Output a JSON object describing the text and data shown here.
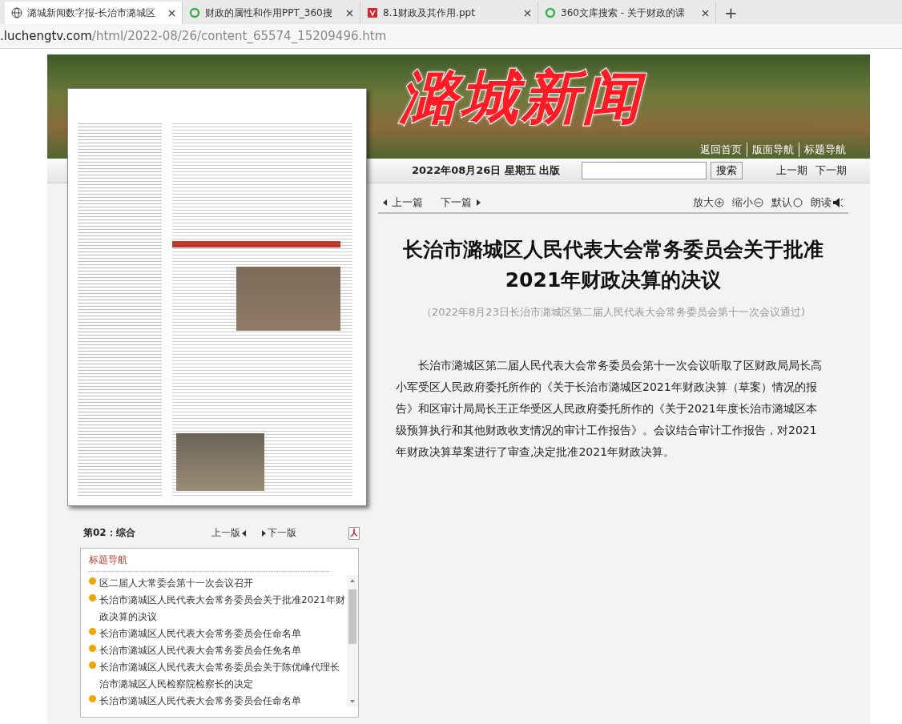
{
  "browser": {
    "tabs": [
      {
        "title": "潞城新闻数字报-长治市潞城区",
        "kind": "globe",
        "selected": true
      },
      {
        "title": "财政的属性和作用PPT_360搜",
        "kind": "ring",
        "selected": false
      },
      {
        "title": "8.1财政及其作用.ppt",
        "kind": "doc",
        "selected": false
      },
      {
        "title": "360文库搜索 - 关于财政的课",
        "kind": "ring",
        "selected": false
      }
    ],
    "new_tab": "+",
    "address": {
      "host": ".luchengtv.com",
      "path": "/html/2022-08/26/content_65574_15209496.htm"
    }
  },
  "banner": {
    "logo": "潞城新闻",
    "links": [
      "返回首页",
      "版面导航",
      "标题导航"
    ]
  },
  "date_bar": {
    "date": "2022年08月26日 星期五 出版",
    "search_button": "搜索",
    "prev_issue": "上一期",
    "next_issue": "下一期"
  },
  "article_nav": {
    "prev": "上一篇",
    "next": "下一篇",
    "tools": [
      {
        "label": "放大",
        "kind": "plus"
      },
      {
        "label": "缩小",
        "kind": "minus"
      },
      {
        "label": "默认",
        "kind": "circle"
      },
      {
        "label": "朗读",
        "kind": "speaker"
      }
    ]
  },
  "article": {
    "title": "长治市潞城区人民代表大会常务委员会关于批准2021年财政决算的决议",
    "subtitle": "（2022年8月23日长治市潞城区第二届人民代表大会常务委员会第十一次会议通过)",
    "body": "长治市潞城区第二届人民代表大会常务委员会第十一次会议听取了区财政局局长高小军受区人民政府委托所作的《关于长治市潞城区2021年财政决算（草案）情况的报告》和区审计局局长王正华受区人民政府委托所作的《关于2021年度长治市潞城区本级预算执行和其他财政收支情况的审计工作报告》。会议结合审计工作报告，对2021年财政决算草案进行了审查,决定批准2021年财政决算。"
  },
  "page_nav": {
    "page_label": "第02：综合",
    "prev_page": "上一版",
    "next_page": "下一版"
  },
  "title_nav": {
    "heading": "标题导航",
    "items": [
      "区二届人大常委会第十一次会议召开",
      "长治市潞城区人民代表大会常务委员会关于批准2021年财政决算的决议",
      "长治市潞城区人民代表大会常务委员会任命名单",
      "长治市潞城区人民代表大会常务委员会任免名单",
      "长治市潞城区人民代表大会常务委员会关于陈优峰代理长治市潞城区人民检察院检察长的决定",
      "长治市潞城区人民代表大会常务委员会任命名单"
    ]
  }
}
